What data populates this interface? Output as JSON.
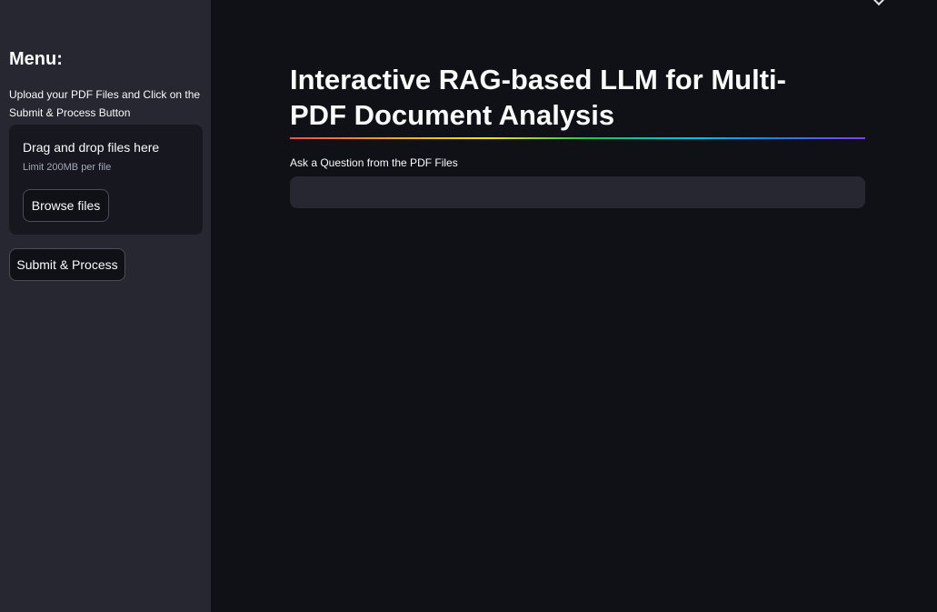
{
  "sidebar": {
    "title": "Menu:",
    "description": "Upload your PDF Files and Click on the Submit & Process Button",
    "uploader": {
      "drag_text": "Drag and drop files here",
      "limit_text": "Limit 200MB per file",
      "browse_label": "Browse files"
    },
    "submit_label": "Submit & Process"
  },
  "main": {
    "title": "Interactive RAG-based LLM for Multi-PDF Document Analysis",
    "question_label": "Ask a Question from the PDF Files",
    "question_value": ""
  },
  "colors": {
    "sidebar_bg": "#262730",
    "main_bg": "#0f1117",
    "uploader_bg": "#16171f",
    "input_bg": "#262730",
    "text": "#fafafa"
  },
  "icons": {
    "top_menu": "chevron-down-icon"
  }
}
